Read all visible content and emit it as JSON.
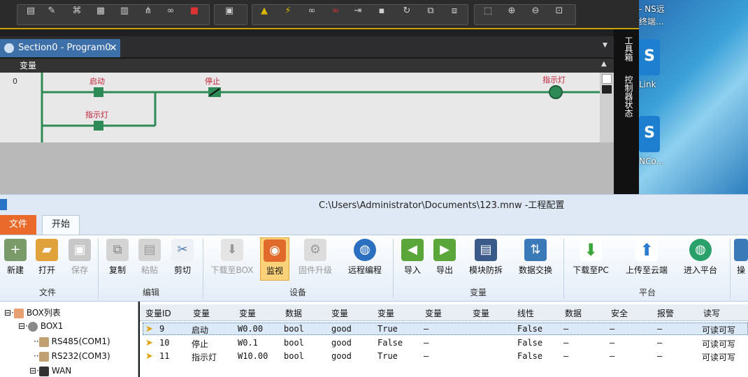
{
  "editor": {
    "tab_label": "Section0 - Program0",
    "close_glyph": "✕",
    "dropdown_glyph": "▼",
    "var_header": "变量",
    "collapse_glyph": "▲"
  },
  "ladder": {
    "rung_number": "0",
    "contact1_label": "启动",
    "contact2_label": "停止",
    "coil_label": "指示灯",
    "parallel_contact_label": "指示灯"
  },
  "right_strip": {
    "label1": "工具箱",
    "label2": "控制器状态"
  },
  "desktop": {
    "line1": "- NS远",
    "line2": "终端...",
    "icon1_label": "Link",
    "icon2_label": "NCo..."
  },
  "app": {
    "title": "C:\\Users\\Administrator\\Documents\\123.mnw  -工程配置",
    "tabs": {
      "file": "文件",
      "start": "开始"
    },
    "ribbon": {
      "new": "新建",
      "open": "打开",
      "save": "保存",
      "copy": "复制",
      "paste": "粘贴",
      "cut": "剪切",
      "download_box": "下载至BOX",
      "monitor": "监视",
      "firmware": "固件升级",
      "remote": "远程编程",
      "import": "导入",
      "export": "导出",
      "module_protect": "模块防拆",
      "data_exchange": "数据交换",
      "download_pc": "下载至PC",
      "upload_cloud": "上传至云端",
      "enter_platform": "进入平台",
      "operate": "操",
      "group_file": "文件",
      "group_edit": "编辑",
      "group_device": "设备",
      "group_var": "变量",
      "group_platform": "平台"
    }
  },
  "tree": {
    "root": "BOX列表",
    "box": "BOX1",
    "com1": "RS485(COM1)",
    "com3": "RS232(COM3)",
    "wan": "WAN"
  },
  "grid": {
    "headers": [
      "变量ID",
      "变量",
      "变量",
      "数据",
      "变量",
      "变量",
      "变量",
      "变量",
      "线性",
      "数据",
      "安全",
      "报警",
      "读写"
    ],
    "rows": [
      [
        "9",
        "启动",
        "W0.00",
        "bool",
        "good",
        "True",
        "—",
        "",
        "False",
        "—",
        "—",
        "—",
        "可读可写"
      ],
      [
        "10",
        "停止",
        "W0.1",
        "bool",
        "good",
        "False",
        "—",
        "",
        "False",
        "—",
        "—",
        "—",
        "可读可写"
      ],
      [
        "11",
        "指示灯",
        "W10.00",
        "bool",
        "good",
        "True",
        "—",
        "",
        "False",
        "—",
        "—",
        "—",
        "可读可写"
      ]
    ]
  },
  "colors": {
    "accent": "#3d6fa8",
    "ladder_green": "#2e8b57",
    "label_red": "#c0203a",
    "file_tab": "#e96a2a"
  }
}
